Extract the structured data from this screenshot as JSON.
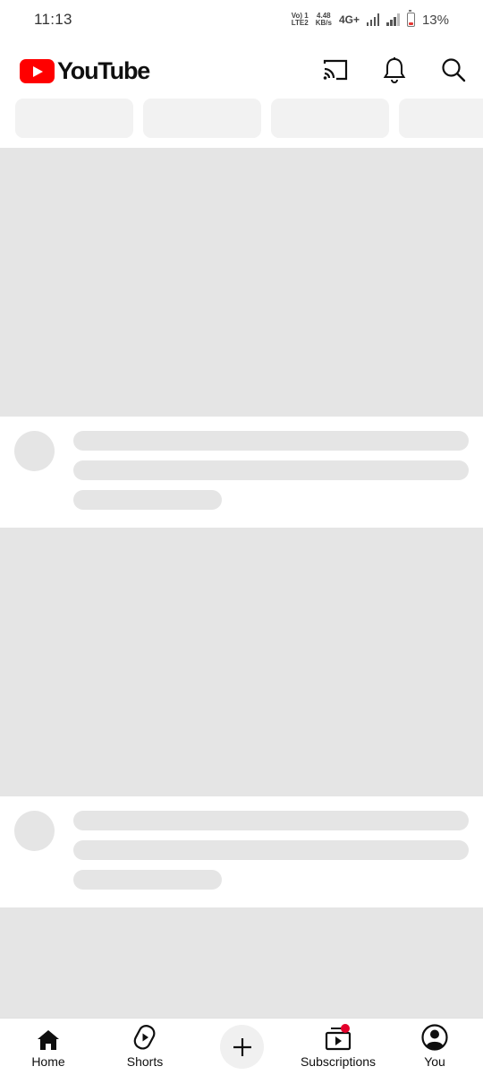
{
  "status_bar": {
    "time": "11:13",
    "volte_top": "Vo) 1",
    "volte_bottom": "LTE2",
    "speed_value": "4.48",
    "speed_unit": "KB/s",
    "network": "4G+",
    "battery": "13%"
  },
  "header": {
    "logo_text": "YouTube",
    "icons": [
      "cast-icon",
      "notifications-bell-icon",
      "search-icon"
    ]
  },
  "bottom_nav": {
    "home": "Home",
    "shorts": "Shorts",
    "subscriptions": "Subscriptions",
    "you": "You"
  },
  "colors": {
    "brand_red": "#ff0000",
    "skeleton": "#e5e5e5",
    "chip": "#f2f2f2",
    "badge": "#e4002b"
  }
}
